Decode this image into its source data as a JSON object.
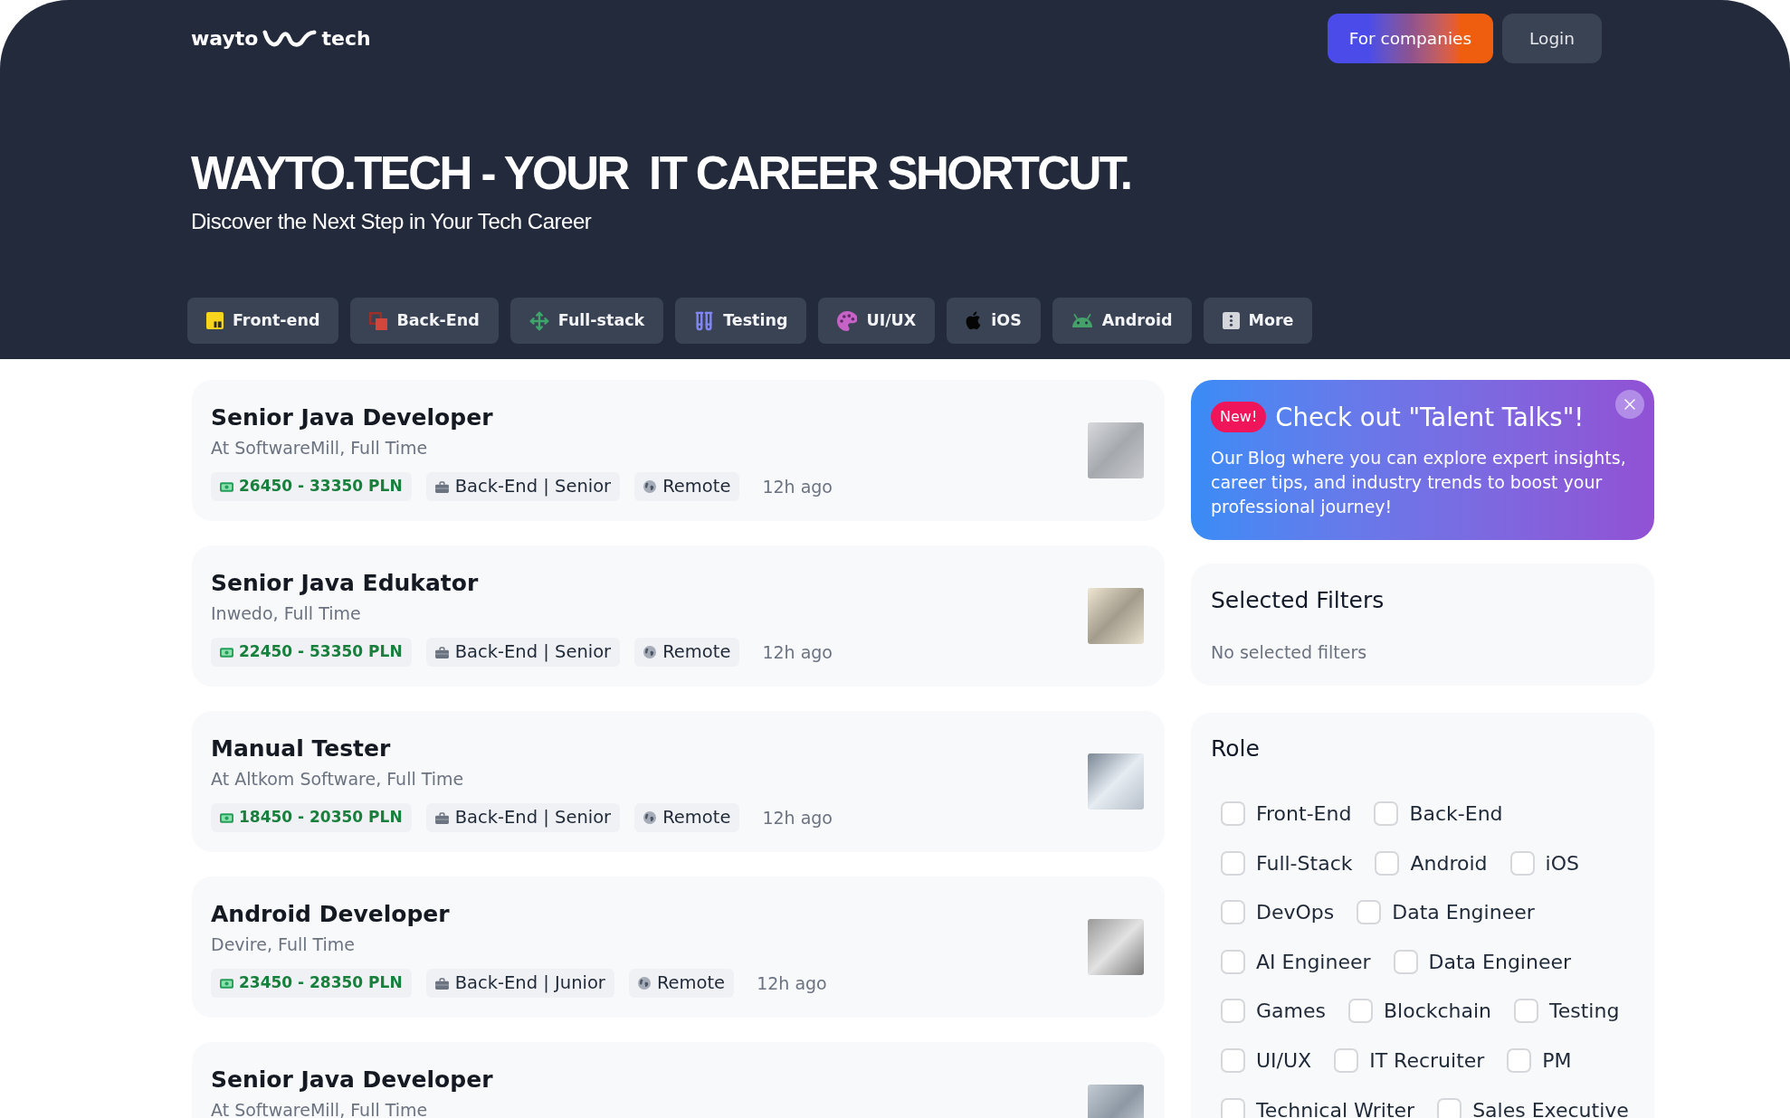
{
  "header": {
    "logo": {
      "left": "wayto",
      "right": "tech"
    },
    "actions": [
      {
        "label": "For companies",
        "kind": "primary"
      },
      {
        "label": "Login",
        "kind": "secondary"
      }
    ]
  },
  "hero": {
    "title": "WAYTO.TECH - YOUR  IT CAREER SHORTCUT.",
    "subtitle": "Discover the Next Step in Your Tech Career"
  },
  "categories": [
    {
      "label": "Front-end"
    },
    {
      "label": "Back-End"
    },
    {
      "label": "Full-stack"
    },
    {
      "label": "Testing"
    },
    {
      "label": "UI/UX"
    },
    {
      "label": "iOS"
    },
    {
      "label": "Android"
    },
    {
      "label": "More"
    }
  ],
  "jobs": [
    {
      "title": "Senior Java Developer",
      "company": "At SoftwareMill, Full Time",
      "salary": "26450 - 33350 PLN",
      "category": "Back-End | Senior",
      "location": "Remote",
      "posted": "12h ago"
    },
    {
      "title": "Senior Java Edukator",
      "company": "Inwedo, Full Time",
      "salary": "22450 - 53350 PLN",
      "category": "Back-End | Senior",
      "location": "Remote",
      "posted": "12h ago"
    },
    {
      "title": "Manual Tester",
      "company": "At Altkom Software, Full Time",
      "salary": "18450 - 20350 PLN",
      "category": "Back-End | Senior",
      "location": "Remote",
      "posted": "12h ago"
    },
    {
      "title": "Android Developer",
      "company": "Devire, Full Time",
      "salary": "23450 - 28350 PLN",
      "category": "Back-End | Junior",
      "location": "Remote",
      "posted": "12h ago"
    },
    {
      "title": "Senior Java Developer",
      "company": "At SoftwareMill, Full Time"
    }
  ],
  "promo": {
    "badge": "New!",
    "title": "Check out \"Talent Talks\"!",
    "text": "Our Blog where you can explore expert insights, career tips, and industry trends to boost your professional journey!"
  },
  "selected_filters": {
    "title": "Selected Filters",
    "empty_text": "No selected filters"
  },
  "role_filter": {
    "title": "Role",
    "options": [
      {
        "label": "Front-End",
        "checked": false
      },
      {
        "label": "Back-End",
        "checked": false
      },
      {
        "label": "Full-Stack",
        "checked": false
      },
      {
        "label": "Android",
        "checked": false
      },
      {
        "label": "iOS",
        "checked": false
      },
      {
        "label": "DevOps",
        "checked": false
      },
      {
        "label": "Data Engineer",
        "checked": false
      },
      {
        "label": "AI Engineer",
        "checked": false
      },
      {
        "label": "Data Engineer",
        "checked": false
      },
      {
        "label": "Games",
        "checked": false
      },
      {
        "label": "Blockchain",
        "checked": false
      },
      {
        "label": "Testing",
        "checked": false
      },
      {
        "label": "UI/UX",
        "checked": false
      },
      {
        "label": "IT Recruiter",
        "checked": false
      },
      {
        "label": "PM",
        "checked": false
      },
      {
        "label": "Technical Writer",
        "checked": false
      },
      {
        "label": "Sales Executive",
        "checked": false
      }
    ]
  }
}
